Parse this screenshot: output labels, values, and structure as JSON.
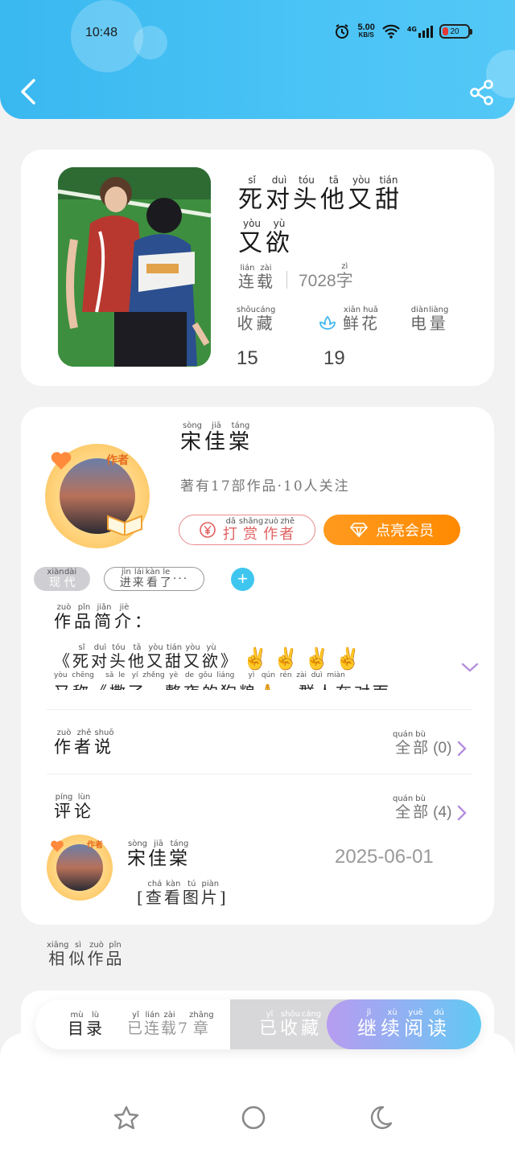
{
  "status_bar": {
    "time": "10:48",
    "net_speed": "5.00",
    "net_unit": "KB/S",
    "net_type": "4G",
    "battery": "20",
    "battery_level": 0.2
  },
  "book": {
    "title_line1": [
      "死",
      "对",
      "头",
      "他",
      "又",
      "甜"
    ],
    "title_line1_py": [
      "sǐ",
      "duì",
      "tóu",
      "tā",
      "yòu",
      "tián"
    ],
    "title_line2": [
      "又",
      "欲"
    ],
    "title_line2_py": [
      "yòu",
      "yù"
    ],
    "status": [
      "连",
      "载"
    ],
    "status_py": [
      "lián",
      "zài"
    ],
    "word_count": "7028",
    "word_unit": "字",
    "word_unit_py": "zì",
    "stats": [
      {
        "label": [
          "收",
          "藏"
        ],
        "py": [
          "shōu",
          "cáng"
        ],
        "value": "15"
      },
      {
        "label": [
          "鲜",
          "花"
        ],
        "py": [
          "xiān",
          "huā"
        ],
        "value": "19",
        "icon": "flower-icon"
      },
      {
        "label": [
          "电",
          "量"
        ],
        "py": [
          "diàn",
          "liàng"
        ],
        "value": ""
      }
    ]
  },
  "author": {
    "name": [
      "宋",
      "佳",
      "棠"
    ],
    "name_py": [
      "sòng",
      "jiā",
      "táng"
    ],
    "badge": "作者",
    "sub_a": "著有17部作品",
    "sub_b": "10人关注",
    "tip_label": [
      "打",
      "赏",
      "作",
      "者"
    ],
    "tip_py": [
      "dǎ",
      "shǎng",
      "zuò",
      "zhě"
    ],
    "vip_label": "点亮会员"
  },
  "tags": [
    {
      "label": [
        "现",
        "代"
      ],
      "py": [
        "xiàn",
        "dài"
      ]
    },
    {
      "label": [
        "进",
        "来",
        "看",
        "了",
        "···"
      ],
      "py": [
        "jìn",
        "lái",
        "kàn",
        "le",
        ""
      ]
    }
  ],
  "intro": {
    "heading": [
      "作",
      "品",
      "简",
      "介",
      "："
    ],
    "heading_py": [
      "zuò",
      "pǐn",
      "jiǎn",
      "jiè",
      ""
    ],
    "line1": [
      "《",
      "死",
      "对",
      "头",
      "他",
      "又",
      "甜",
      "又",
      "欲",
      "》"
    ],
    "line1_py": [
      "",
      "sǐ",
      "duì",
      "tóu",
      "tā",
      "yòu",
      "tián",
      "yòu",
      "yù",
      ""
    ],
    "line1_emoji": "✌✌✌✌",
    "line2_py": "yòu  chēng     sǎ  le   yí  zhěng  yè   de  gǒu  liáng      yì   qún  rén  zài  duì  miàn",
    "line2": "又称《撒了一整夜的狗粮🙏一群人在对面···"
  },
  "author_says": {
    "heading": [
      "作",
      "者",
      "说"
    ],
    "heading_py": [
      "zuò",
      "zhě",
      "shuō"
    ],
    "more": [
      "全",
      "部"
    ],
    "more_py": [
      "quán",
      "bù"
    ],
    "count": "(0)"
  },
  "comments": {
    "heading": [
      "评",
      "论"
    ],
    "heading_py": [
      "píng",
      "lùn"
    ],
    "more": [
      "全",
      "部"
    ],
    "more_py": [
      "quán",
      "bù"
    ],
    "count": "(4)",
    "item": {
      "name": [
        "宋",
        "佳",
        "棠"
      ],
      "name_py": [
        "sòng",
        "jiā",
        "táng"
      ],
      "date": "2025-06-01",
      "content": [
        "[",
        "查",
        "看",
        "图",
        "片",
        "]"
      ],
      "content_py": [
        "",
        "chá",
        "kàn",
        "tú",
        "piàn",
        ""
      ]
    }
  },
  "similar": {
    "heading": [
      "相",
      "似",
      "作",
      "品"
    ],
    "heading_py": [
      "xiāng",
      "sì",
      "zuò",
      "pǐn"
    ]
  },
  "action_bar": {
    "toc": [
      "目",
      "录"
    ],
    "toc_py": [
      "mù",
      "lù"
    ],
    "chapters": [
      "已",
      "连",
      "载",
      "7",
      "章"
    ],
    "chapters_py": [
      "yǐ",
      "lián",
      "zài",
      "",
      "zhāng"
    ],
    "collected": [
      "已",
      "收",
      "藏"
    ],
    "collected_py": [
      "yǐ",
      "shōu",
      "cáng"
    ],
    "read": [
      "继",
      "续",
      "阅",
      "读"
    ],
    "read_py": [
      "jì",
      "xù",
      "yuè",
      "dú"
    ]
  },
  "nav_icons": [
    "star-icon",
    "circle-icon",
    "moon-icon"
  ],
  "colors": {
    "header": "#3fbdf2",
    "accent_orange": "#ff8a00",
    "tip_red": "#e06060",
    "read_gradient_start": "#b79cf0",
    "read_gradient_end": "#5fcaf3"
  }
}
